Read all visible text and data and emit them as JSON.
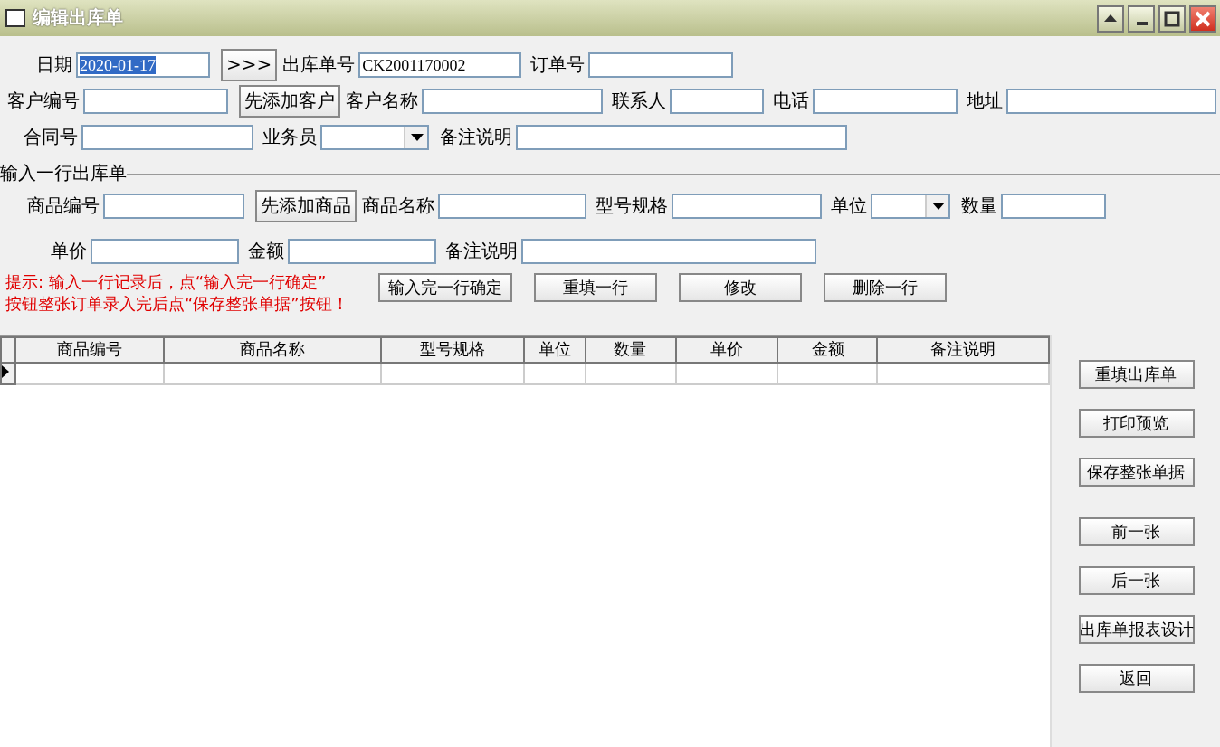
{
  "window": {
    "title": "编辑出库单"
  },
  "header_rows": [
    [
      {
        "kind": "label",
        "text": "日期"
      },
      {
        "kind": "field",
        "value": "2020-01-17",
        "highlighted": true
      },
      {
        "kind": "button",
        "label": ">>>"
      },
      {
        "kind": "label",
        "text": "出库单号"
      },
      {
        "kind": "field",
        "value": "CK2001170002",
        "highlighted": false
      },
      {
        "kind": "label",
        "text": "订单号"
      },
      {
        "kind": "field"
      }
    ],
    [
      {
        "kind": "label",
        "text": "客户编号"
      },
      {
        "kind": "field"
      },
      {
        "kind": "button",
        "label": "先添加客户"
      },
      {
        "kind": "label",
        "text": "客户名称"
      },
      {
        "kind": "field"
      },
      {
        "kind": "label",
        "text": "联系人"
      },
      {
        "kind": "field"
      },
      {
        "kind": "label",
        "text": "电话"
      },
      {
        "kind": "field"
      },
      {
        "kind": "label",
        "text": "地址"
      },
      {
        "kind": "field"
      }
    ],
    [
      {
        "kind": "label",
        "text": "合同号"
      },
      {
        "kind": "field"
      },
      {
        "kind": "label",
        "text": "业务员"
      },
      {
        "kind": "select"
      },
      {
        "kind": "label",
        "text": "备注说明"
      },
      {
        "kind": "field"
      }
    ]
  ],
  "section": {
    "title": "输入一行出库单"
  },
  "line_rows": [
    [
      {
        "kind": "label",
        "text": "商品编号"
      },
      {
        "kind": "field"
      },
      {
        "kind": "button",
        "label": "先添加商品"
      },
      {
        "kind": "label",
        "text": "商品名称"
      },
      {
        "kind": "field"
      },
      {
        "kind": "label",
        "text": "型号规格"
      },
      {
        "kind": "field"
      },
      {
        "kind": "label",
        "text": "单位"
      },
      {
        "kind": "select"
      },
      {
        "kind": "label",
        "text": "数量"
      },
      {
        "kind": "field"
      }
    ],
    [
      {
        "kind": "label",
        "text": "单价"
      },
      {
        "kind": "field"
      },
      {
        "kind": "label",
        "text": "金额"
      },
      {
        "kind": "field"
      },
      {
        "kind": "label",
        "text": "备注说明"
      },
      {
        "kind": "field"
      }
    ]
  ],
  "hint": [
    "提示: 输入一行记录后，点“输入完一行确定”",
    "按钮整张订单录入完后点“保存整张单据”按钮！"
  ],
  "line_buttons": [
    "输入完一行确定",
    "重填一行",
    "修改",
    "删除一行"
  ],
  "table": {
    "columns": [
      "商品编号",
      "商品名称",
      "型号规格",
      "单位",
      "数量",
      "单价",
      "金额",
      "备注说明"
    ],
    "new_row": {
      "current": true
    }
  },
  "side_buttons": [
    "重填出库单",
    "打印预览",
    "保存整张单据",
    "前一张",
    "后一张",
    "出库单报表设计",
    "返回"
  ]
}
